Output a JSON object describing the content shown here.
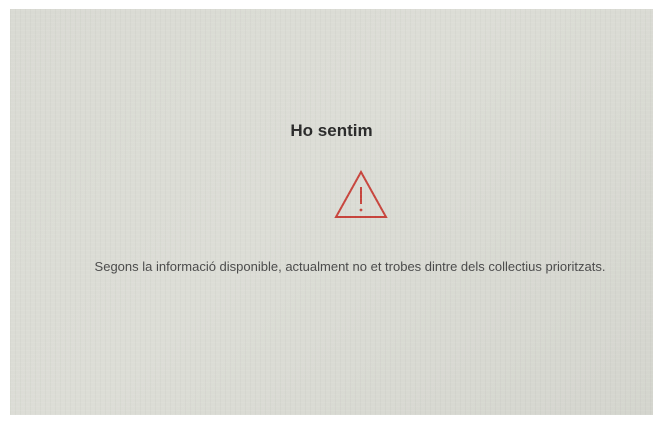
{
  "dialog": {
    "title": "Ho sentim",
    "icon": "warning-triangle-icon",
    "icon_color": "#c8453d",
    "message": "Segons la informació disponible, actualment no et trobes dintre dels collectius prioritzats."
  }
}
